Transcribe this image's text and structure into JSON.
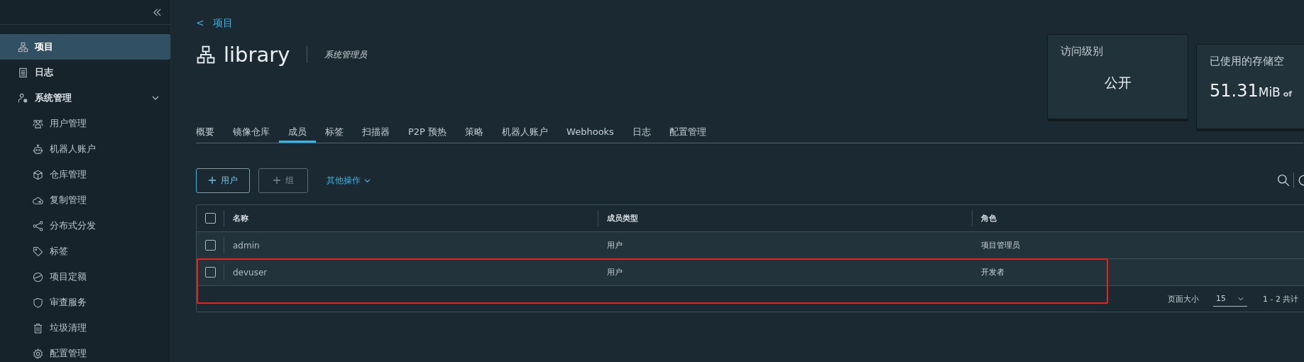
{
  "sidebar": {
    "items": [
      {
        "label": "项目",
        "selected": true
      },
      {
        "label": "日志",
        "selected": false
      },
      {
        "label": "系统管理",
        "selected": false,
        "expanded": true,
        "children": [
          {
            "label": "用户管理",
            "selected": false
          },
          {
            "label": "机器人账户",
            "selected": false
          },
          {
            "label": "仓库管理",
            "selected": false
          },
          {
            "label": "复制管理",
            "selected": false
          },
          {
            "label": "分布式分发",
            "selected": false
          },
          {
            "label": "标签",
            "selected": false
          },
          {
            "label": "项目定额",
            "selected": false
          },
          {
            "label": "审查服务",
            "selected": false
          },
          {
            "label": "垃圾清理",
            "selected": false
          },
          {
            "label": "配置管理",
            "selected": false
          }
        ]
      }
    ]
  },
  "breadcrumb": {
    "back": "<",
    "label": "项目"
  },
  "project": {
    "name": "library",
    "role": "系统管理员"
  },
  "cards": [
    {
      "kind": "text",
      "title": "访问级别",
      "value": "公开"
    },
    {
      "kind": "storage",
      "title": "已使用的存储空",
      "value": "51.31",
      "unit": "MiB",
      "of": "of"
    }
  ],
  "tabs": [
    {
      "label": "概要",
      "selected": false
    },
    {
      "label": "镜像仓库",
      "selected": false
    },
    {
      "label": "成员",
      "selected": true
    },
    {
      "label": "标签",
      "selected": false
    },
    {
      "label": "扫描器",
      "selected": false
    },
    {
      "label": "P2P 预热",
      "selected": false
    },
    {
      "label": "策略",
      "selected": false
    },
    {
      "label": "机器人账户",
      "selected": false
    },
    {
      "label": "Webhooks",
      "selected": false
    },
    {
      "label": "日志",
      "selected": false
    },
    {
      "label": "配置管理",
      "selected": false
    }
  ],
  "actions": [
    {
      "label": "用户",
      "disabled": false
    },
    {
      "label": "组",
      "disabled": true
    }
  ],
  "more_actions": "其他操作",
  "table": {
    "select_all": false,
    "columns": [
      "名称",
      "成员类型",
      "角色"
    ],
    "rows": [
      {
        "name": "admin",
        "type": "用户",
        "role": "项目管理员",
        "checked": false,
        "highlighted": false
      },
      {
        "name": "devuser",
        "type": "用户",
        "role": "开发者",
        "checked": false,
        "highlighted": true
      }
    ],
    "footer": {
      "page_size_label": "页面大小",
      "page_size": "15",
      "range": "1 - 2 共计"
    }
  }
}
